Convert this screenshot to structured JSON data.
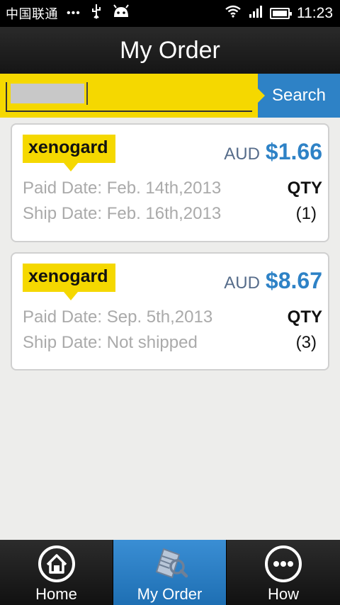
{
  "status_bar": {
    "carrier": "中国联通",
    "dots": "•••",
    "usb_icon": "usb-icon",
    "android_icon": "android-icon",
    "wifi_icon": "wifi-icon",
    "signal_icon": "signal-icon",
    "battery_icon": "battery-icon",
    "time": "11:23"
  },
  "header": {
    "title": "My Order"
  },
  "search": {
    "placeholder": "",
    "value": "",
    "button_label": "Search"
  },
  "orders": [
    {
      "brand": "xenogard",
      "currency": "AUD",
      "price": "$1.66",
      "paid_date": "Paid Date: Feb. 14th,2013",
      "ship_date": "Ship Date: Feb. 16th,2013",
      "qty_label": "QTY",
      "qty": "(1)"
    },
    {
      "brand": "xenogard",
      "currency": "AUD",
      "price": "$8.67",
      "paid_date": "Paid Date: Sep. 5th,2013",
      "ship_date": "Ship Date: Not shipped",
      "qty_label": "QTY",
      "qty": "(3)"
    }
  ],
  "nav": {
    "items": [
      {
        "label": "Home",
        "icon": "home-icon",
        "active": false
      },
      {
        "label": "My Order",
        "icon": "order-search-icon",
        "active": true
      },
      {
        "label": "How",
        "icon": "more-icon",
        "active": false
      }
    ]
  },
  "colors": {
    "accent_yellow": "#f5d800",
    "accent_blue": "#2e82c6",
    "currency_gray": "#566c8a"
  }
}
